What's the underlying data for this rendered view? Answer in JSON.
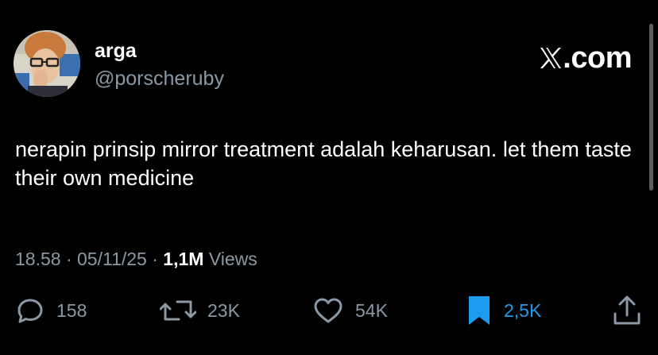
{
  "author": {
    "display_name": "arga",
    "handle": "@porscheruby"
  },
  "brand": {
    "logo_text": ".com",
    "logo_icon": "x-logo-icon"
  },
  "tweet": {
    "text": "nerapin prinsip mirror treatment adalah keharusan. let them taste their own medicine"
  },
  "meta": {
    "time": "18.58",
    "separator": "·",
    "date": "05/11/25",
    "views_count": "1,1M",
    "views_label": "Views"
  },
  "actions": {
    "replies": "158",
    "reposts": "23K",
    "likes": "54K",
    "bookmarks": "2,5K"
  },
  "colors": {
    "background": "#000000",
    "primary_text": "#ffffff",
    "secondary_text": "#8b98a5",
    "bookmark_accent": "#1d9bf0"
  }
}
